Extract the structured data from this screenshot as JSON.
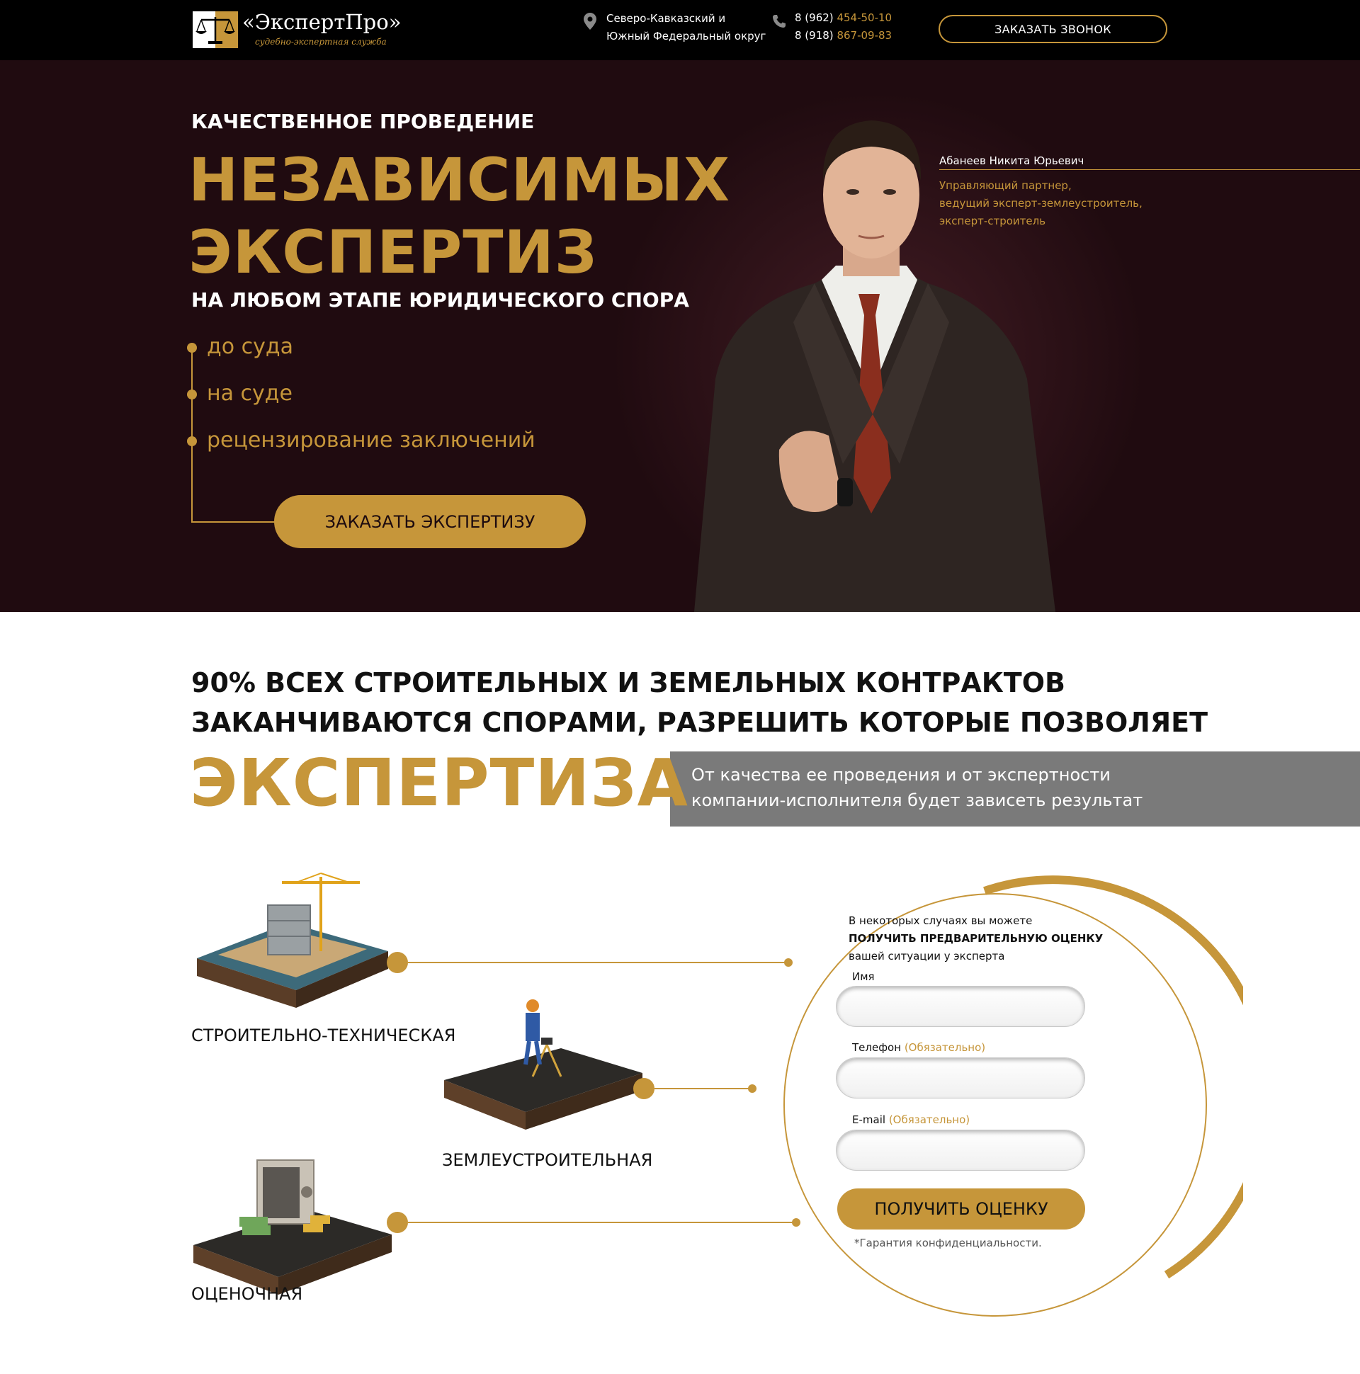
{
  "header": {
    "logo_title": "«ЭкспертПро»",
    "logo_subtitle": "судебно-экспертная служба",
    "region_line1": "Северо-Кавказский и",
    "region_line2": "Южный Федеральный округ",
    "phone1_prefix": "8 (962)",
    "phone1_number": "454-50-10",
    "phone2_prefix": "8 (918)",
    "phone2_number": "867-09-83",
    "callback_label": "ЗАКАЗАТЬ ЗВОНОК"
  },
  "hero": {
    "kicker": "КАЧЕСТВЕННОЕ ПРОВЕДЕНИЕ",
    "title_line1": "НЕЗАВИСИМЫХ",
    "title_line2": "ЭКСПЕРТИЗ",
    "subtitle": "НА ЛЮБОМ ЭТАПЕ ЮРИДИЧЕСКОГО СПОРА",
    "bullets": [
      "до суда",
      "на суде",
      "рецензирование заключений"
    ],
    "order_label": "ЗАКАЗАТЬ ЭКСПЕРТИЗУ",
    "expert_name": "Абанеев Никита Юрьевич",
    "expert_role_line1": "Управляющий партнер,",
    "expert_role_line2": "ведущий эксперт-землеустроитель,",
    "expert_role_line3": "эксперт-строитель"
  },
  "stats": {
    "line1": "90% ВСЕХ СТРОИТЕЛЬНЫХ И ЗЕМЕЛЬНЫХ КОНТРАКТОВ",
    "line2": "ЗАКАНЧИВАЮТСЯ СПОРАМИ, РАЗРЕШИТЬ КОТОРЫЕ ПОЗВОЛЯЕТ",
    "big_word": "ЭКСПЕРТИЗА",
    "box_line1": "От качества ее проведения и от экспертности",
    "box_line2": "компании-исполнителя будет зависеть результат"
  },
  "types": [
    {
      "label": "СТРОИТЕЛЬНО-ТЕХНИЧЕСКАЯ"
    },
    {
      "label": "ЗЕМЛЕУСТРОИТЕЛЬНАЯ"
    },
    {
      "label": "ОЦЕНОЧНАЯ"
    }
  ],
  "form": {
    "intro_line1": "В некоторых случаях вы можете",
    "intro_line2": "ПОЛУЧИТЬ ПРЕДВАРИТЕЛЬНУЮ ОЦЕНКУ",
    "intro_line3": "вашей ситуации у эксперта",
    "name_label": "Имя",
    "phone_label": "Телефон",
    "email_label": "E-mail",
    "required_note": "(Обязательно)",
    "name_value": "",
    "phone_value": "",
    "email_value": "",
    "submit_label": "ПОЛУЧИТЬ ОЦЕНКУ",
    "privacy": "*Гарантия конфиденциальности."
  },
  "colors": {
    "accent": "#c6963a",
    "hero_bg": "#200b10",
    "header_bg": "#000000",
    "box_bg": "#7a7a7a"
  },
  "icons": {
    "logo": "scales-of-justice-icon",
    "region": "map-pin-icon",
    "phone": "phone-icon"
  }
}
